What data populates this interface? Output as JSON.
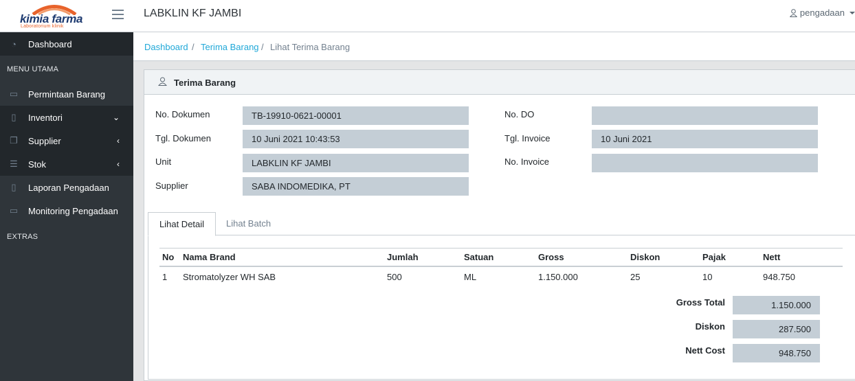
{
  "brand": {
    "name": "kimia farma",
    "sub": "Laboratorium klinik"
  },
  "header": {
    "title": "LABKLIN KF JAMBI",
    "user": "pengadaan"
  },
  "sidebar": {
    "dashboard": "Dashboard",
    "section_main": "MENU UTAMA",
    "items": [
      {
        "label": "Permintaan Barang"
      },
      {
        "label": "Inventori",
        "chevron": "⌄"
      },
      {
        "label": "Supplier",
        "chevron": "‹"
      },
      {
        "label": "Stok",
        "chevron": "‹"
      },
      {
        "label": "Laporan Pengadaan"
      },
      {
        "label": "Monitoring Pengadaan"
      }
    ],
    "section_extras": "EXTRAS"
  },
  "breadcrumb": {
    "items": [
      "Dashboard",
      "Terima Barang",
      "Lihat Terima Barang"
    ],
    "separator": "/"
  },
  "card": {
    "title": "Terima Barang"
  },
  "form": {
    "no_dokumen": {
      "label": "No. Dokumen",
      "value": "TB-19910-0621-00001"
    },
    "tgl_dokumen": {
      "label": "Tgl. Dokumen",
      "value": "10 Juni 2021 10:43:53"
    },
    "unit": {
      "label": "Unit",
      "value": "LABKLIN KF JAMBI"
    },
    "supplier": {
      "label": "Supplier",
      "value": "SABA INDOMEDIKA, PT"
    },
    "no_do": {
      "label": "No. DO",
      "value": ""
    },
    "tgl_invoice": {
      "label": "Tgl. Invoice",
      "value": "10 Juni 2021"
    },
    "no_invoice": {
      "label": "No. Invoice",
      "value": ""
    }
  },
  "tabs": [
    {
      "label": "Lihat Detail"
    },
    {
      "label": "Lihat Batch"
    }
  ],
  "table": {
    "columns": [
      "No",
      "Nama Brand",
      "Jumlah",
      "Satuan",
      "Gross",
      "Diskon",
      "Pajak",
      "Nett"
    ],
    "rows": [
      [
        "1",
        "Stromatolyzer WH SAB",
        "500",
        "ML",
        "1.150.000",
        "25",
        "10",
        "948.750"
      ]
    ]
  },
  "totals": {
    "gross": {
      "label": "Gross Total",
      "value": "1.150.000"
    },
    "diskon": {
      "label": "Diskon",
      "value": "287.500"
    },
    "nett": {
      "label": "Nett Cost",
      "value": "948.750"
    }
  },
  "colors": {
    "sidebar": "#2f353a",
    "link": "#20a8d8",
    "field": "#c4ced6",
    "logo_orange": "#e8632b",
    "logo_blue": "#1d3a70"
  }
}
